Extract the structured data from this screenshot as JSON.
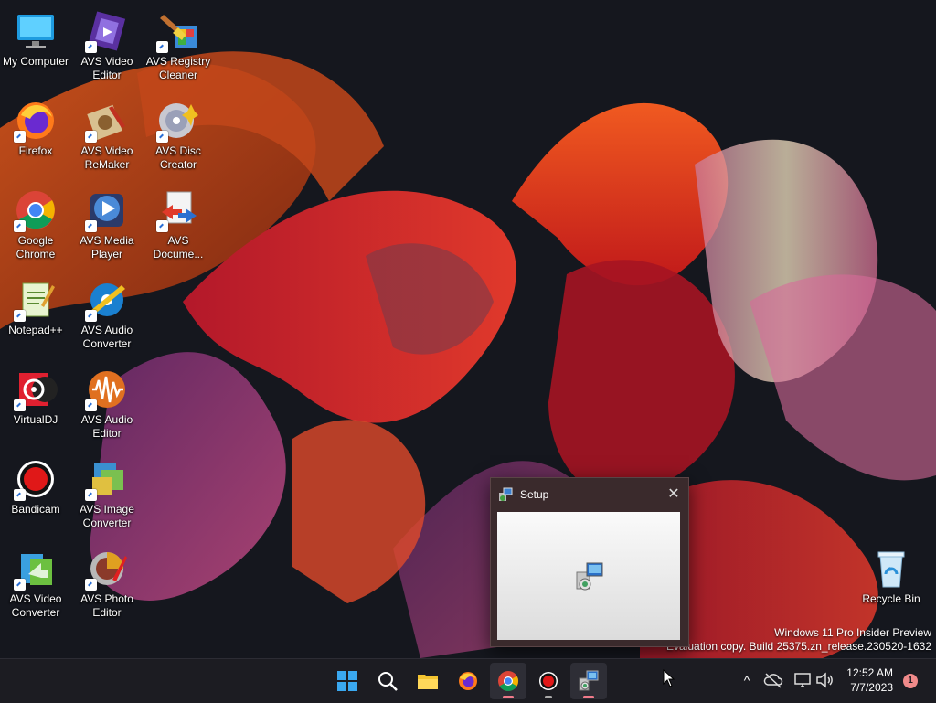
{
  "desktop": {
    "icons": [
      {
        "label": "My Computer"
      },
      {
        "label": "AVS Video Editor"
      },
      {
        "label": "AVS Registry Cleaner"
      },
      {
        "label": "Firefox"
      },
      {
        "label": "AVS Video ReMaker"
      },
      {
        "label": "AVS Disc Creator"
      },
      {
        "label": "Google Chrome"
      },
      {
        "label": "AVS Media Player"
      },
      {
        "label": "AVS Docume..."
      },
      {
        "label": "Notepad++"
      },
      {
        "label": "AVS Audio Converter"
      },
      {
        "label": "VirtualDJ"
      },
      {
        "label": "AVS Audio Editor"
      },
      {
        "label": "Bandicam"
      },
      {
        "label": "AVS Image Converter"
      },
      {
        "label": "AVS Video Converter"
      },
      {
        "label": "AVS Photo Editor"
      },
      {
        "label": "Recycle Bin"
      }
    ],
    "watermark": {
      "line1": "Windows 11 Pro Insider Preview",
      "line2": "Evaluation copy. Build 25375.zn_release.230520-1632"
    }
  },
  "setup_window": {
    "title": "Setup",
    "close_label": "✕"
  },
  "taskbar": {
    "apps": [
      "Start",
      "Search",
      "File Explorer",
      "Firefox",
      "Google Chrome",
      "Bandicam",
      "Setup"
    ],
    "tray": {
      "overflow_label": "^",
      "time": "12:52 AM",
      "date": "7/7/2023",
      "notification_count": "1"
    }
  },
  "colors": {
    "taskbar_bg": "#1c1c22",
    "accent_indicator": "#f07a8a",
    "window_frame": "#3a2a2c"
  }
}
